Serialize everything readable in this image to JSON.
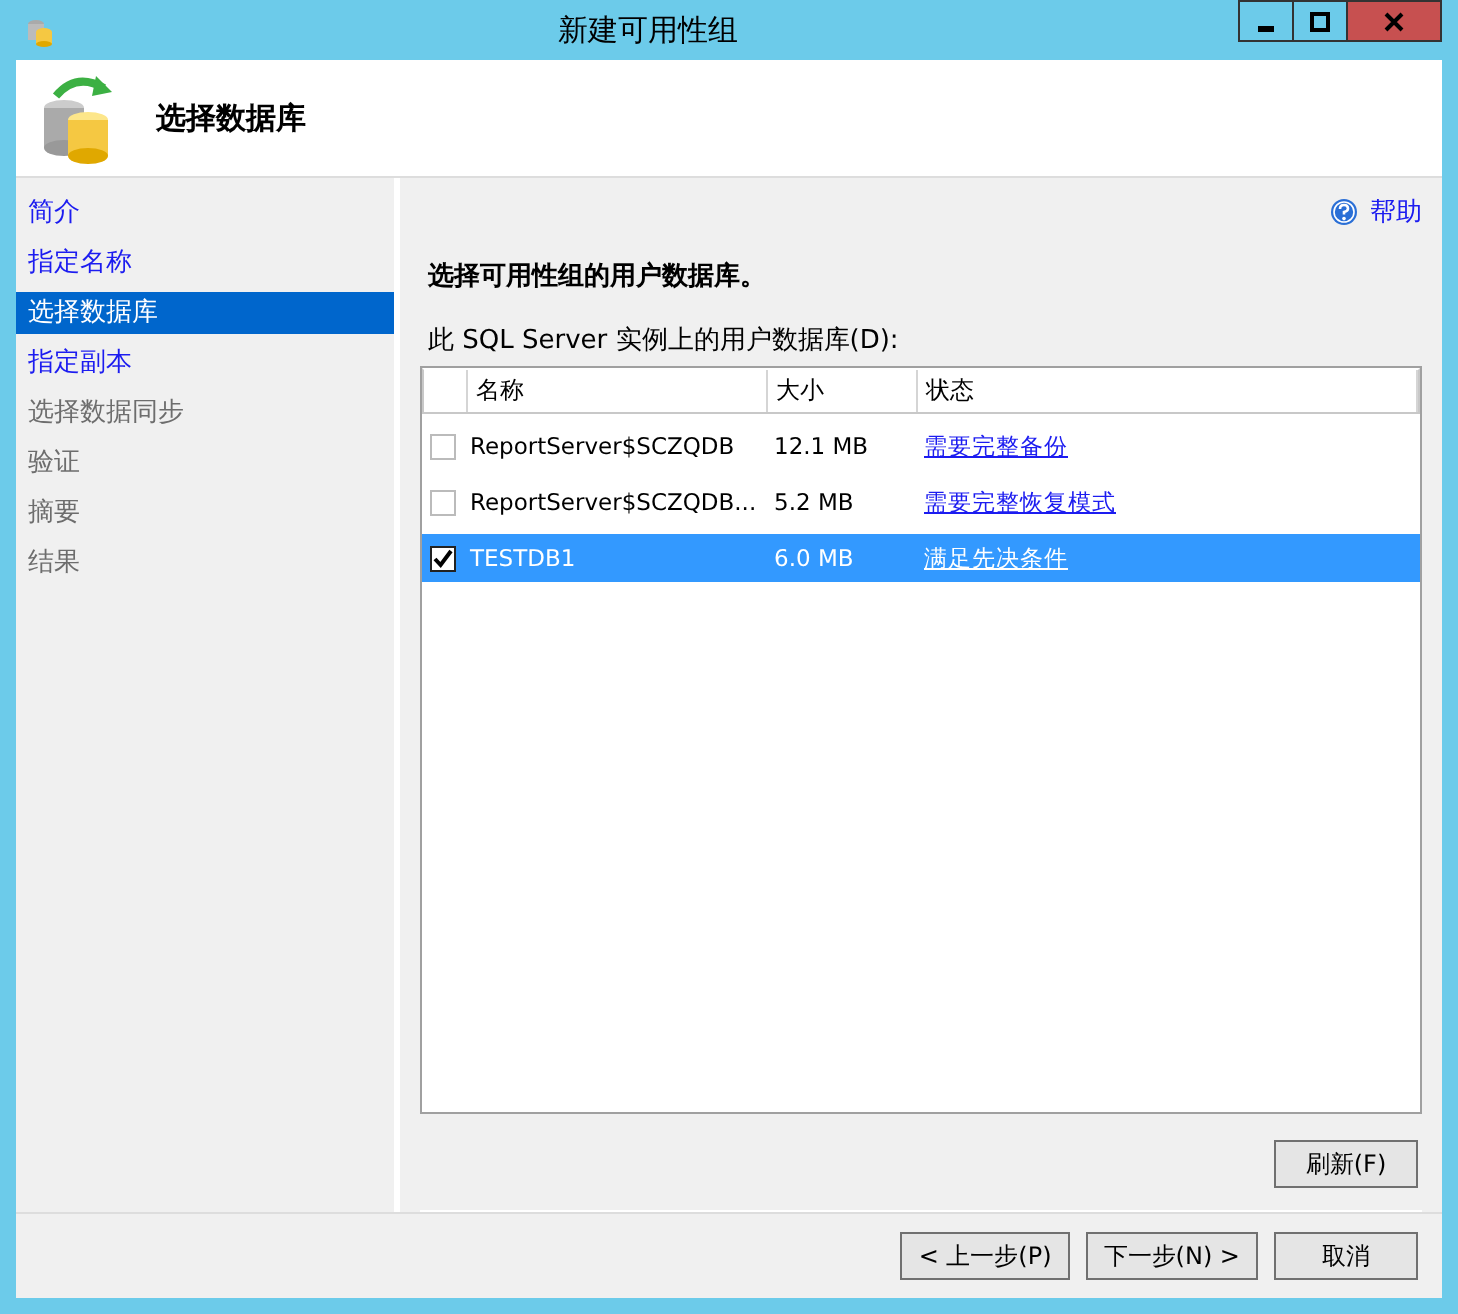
{
  "window": {
    "title": "新建可用性组"
  },
  "header": {
    "title": "选择数据库"
  },
  "sidebar": {
    "items": [
      {
        "label": "简介",
        "selected": false,
        "disabled": false
      },
      {
        "label": "指定名称",
        "selected": false,
        "disabled": false
      },
      {
        "label": "选择数据库",
        "selected": true,
        "disabled": false
      },
      {
        "label": "指定副本",
        "selected": false,
        "disabled": false
      },
      {
        "label": "选择数据同步",
        "selected": false,
        "disabled": true
      },
      {
        "label": "验证",
        "selected": false,
        "disabled": true
      },
      {
        "label": "摘要",
        "selected": false,
        "disabled": true
      },
      {
        "label": "结果",
        "selected": false,
        "disabled": true
      }
    ]
  },
  "help": {
    "label": "帮助"
  },
  "instruction": "选择可用性组的用户数据库。",
  "table": {
    "label": "此 SQL Server 实例上的用户数据库(D):",
    "columns": [
      "名称",
      "大小",
      "状态"
    ],
    "rows": [
      {
        "name": "ReportServer$SCZQDB",
        "size": "12.1 MB",
        "status": "需要完整备份",
        "checked": false,
        "selected": false
      },
      {
        "name": "ReportServer$SCZQDB...",
        "size": "5.2 MB",
        "status": "需要完整恢复模式",
        "checked": false,
        "selected": false
      },
      {
        "name": "TESTDB1",
        "size": "6.0 MB",
        "status": "满足先决条件",
        "checked": true,
        "selected": true
      }
    ]
  },
  "refresh_button": "刷新(F)",
  "buttons": [
    "< 上一步(P)",
    "下一步(N) >",
    "取消"
  ]
}
